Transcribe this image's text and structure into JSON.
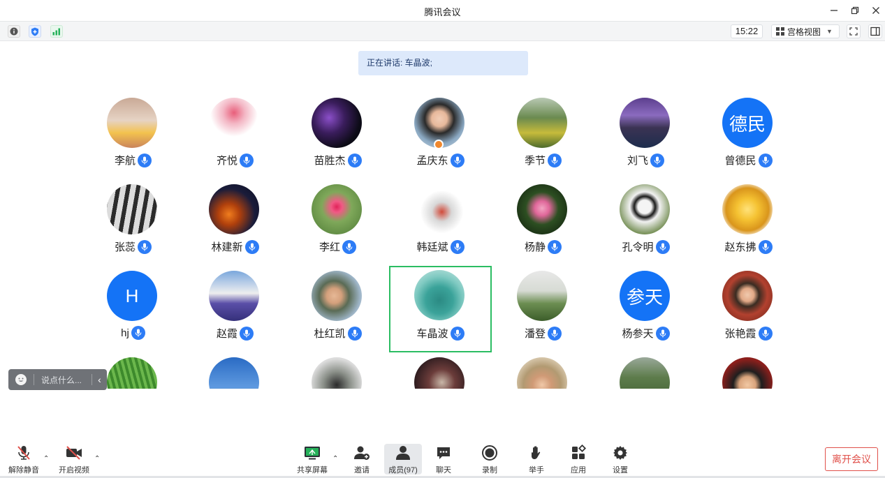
{
  "window": {
    "title": "腾讯会议"
  },
  "toolbar": {
    "clock": "15:22",
    "view_label": "宫格视图"
  },
  "speaking": {
    "text": "正在讲话: 车晶波;"
  },
  "participants": [
    {
      "name": "李航",
      "avatar": "photo"
    },
    {
      "name": "齐悦",
      "avatar": "photo"
    },
    {
      "name": "苗胜杰",
      "avatar": "photo"
    },
    {
      "name": "孟庆东",
      "avatar": "photo",
      "host": true
    },
    {
      "name": "季节",
      "avatar": "photo"
    },
    {
      "name": "刘飞",
      "avatar": "photo"
    },
    {
      "name": "曾德民",
      "avatar_text": "德民"
    },
    {
      "name": "张蕊",
      "avatar": "photo"
    },
    {
      "name": "林建新",
      "avatar": "photo"
    },
    {
      "name": "李红",
      "avatar": "photo"
    },
    {
      "name": "韩廷斌",
      "avatar": "photo"
    },
    {
      "name": "杨静",
      "avatar": "photo"
    },
    {
      "name": "孔令明",
      "avatar": "photo"
    },
    {
      "name": "赵东拂",
      "avatar": "photo"
    },
    {
      "name": "hj",
      "avatar_text": "H"
    },
    {
      "name": "赵霞",
      "avatar": "photo"
    },
    {
      "name": "杜红凯",
      "avatar": "photo"
    },
    {
      "name": "车晶波",
      "avatar": "photo",
      "speaking": true
    },
    {
      "name": "潘登",
      "avatar": "photo"
    },
    {
      "name": "杨参天",
      "avatar_text": "参天"
    },
    {
      "name": "张艳霞",
      "avatar": "photo"
    }
  ],
  "chat": {
    "placeholder": "说点什么..."
  },
  "bottom": {
    "unmute": "解除静音",
    "start_video": "开启视频",
    "share_screen": "共享屏幕",
    "invite": "邀请",
    "members": "成员(97)",
    "chat": "聊天",
    "record": "录制",
    "raise_hand": "举手",
    "apps": "应用",
    "settings": "设置",
    "leave": "离开会议"
  },
  "colors": {
    "accent": "#2d7cf6",
    "avatar_blue": "#1473f6",
    "speaking_border": "#2bbd62",
    "leave_red": "#e0504a"
  }
}
